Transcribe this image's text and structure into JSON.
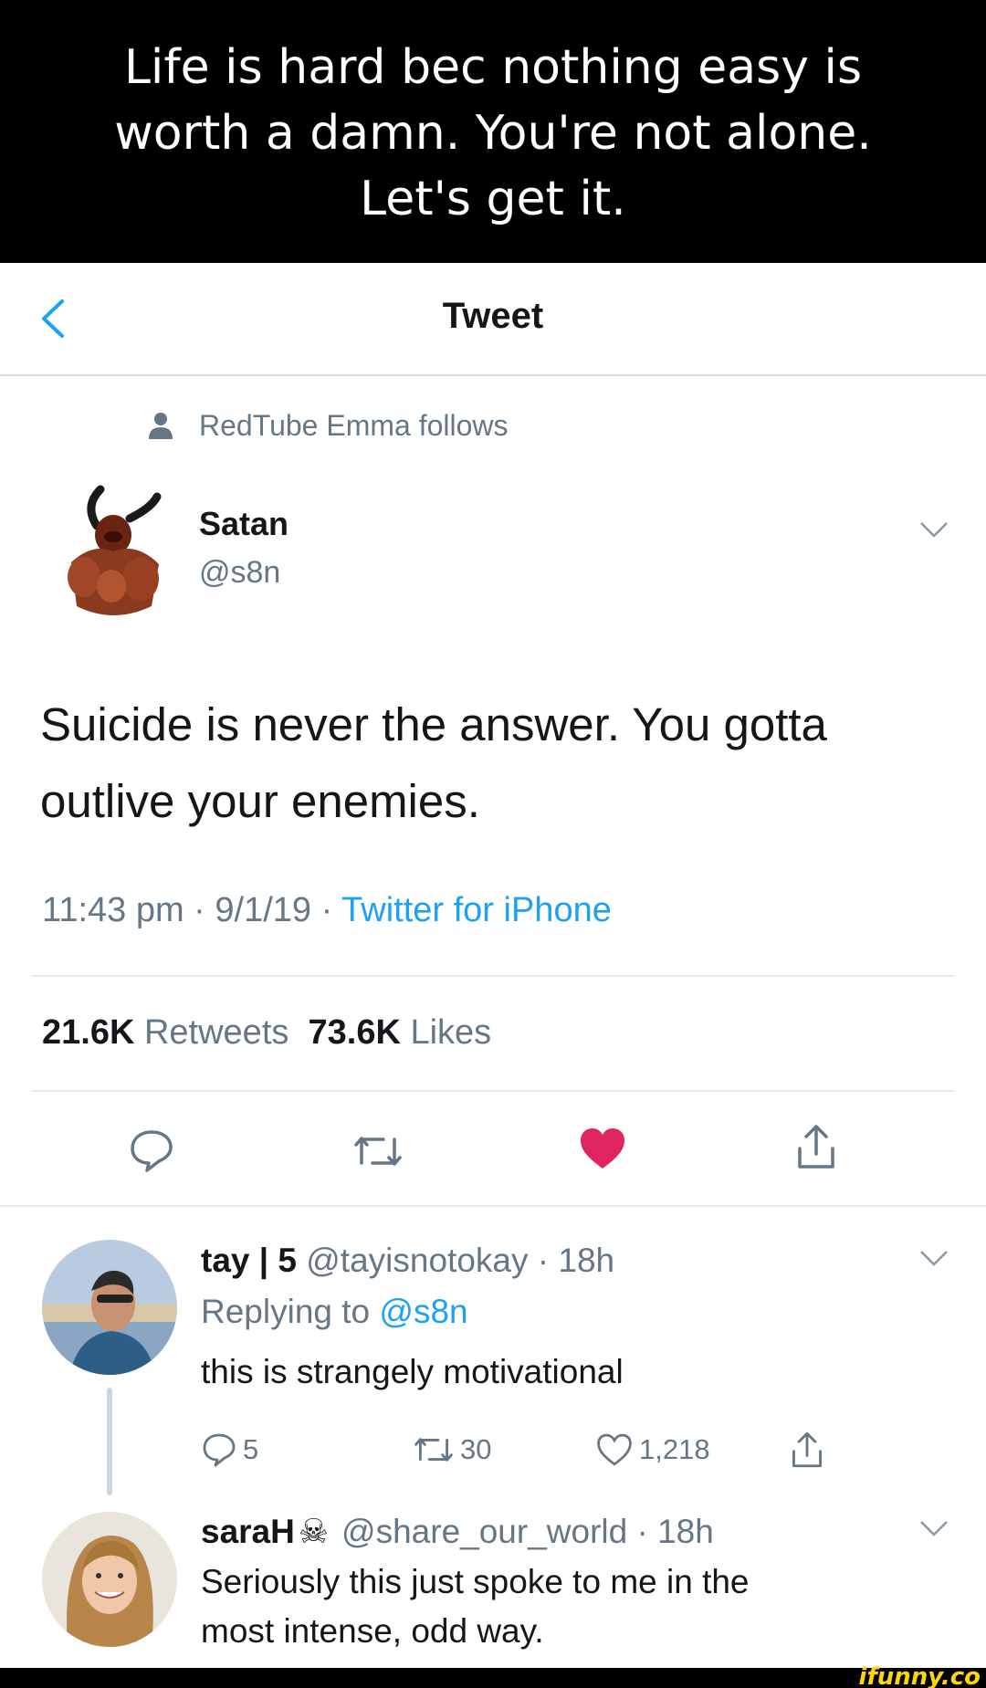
{
  "caption": {
    "line1": "Life is hard bec nothing easy is",
    "line2": "worth a damn. You're not alone.",
    "line3": "Let's get it."
  },
  "header": {
    "title": "Tweet"
  },
  "social_context": "RedTube Emma follows",
  "tweet": {
    "author_name": "Satan",
    "author_handle": "@s8n",
    "text": "Suicide is never the answer. You gotta outlive your enemies.",
    "time": "11:43 pm",
    "date": "9/1/19",
    "source": "Twitter for iPhone",
    "separator": " · ",
    "retweets_count": "21.6K",
    "retweets_label": "Retweets",
    "likes_count": "73.6K",
    "likes_label": "Likes"
  },
  "replies": [
    {
      "name": "tay | 5",
      "handle": "@tayisnotokay",
      "age": "18h",
      "replying_prefix": "Replying to",
      "replying_to": "@s8n",
      "text": "this is strangely motivational",
      "reply_count": "5",
      "retweet_count": "30",
      "like_count": "1,218"
    },
    {
      "name": "saraH",
      "handle": "@share_our_world",
      "age": "18h",
      "text_line1": "Seriously this just spoke to me in the",
      "text_line2": "most intense, odd way."
    }
  ],
  "watermark": "ifunny.co",
  "colors": {
    "accent": "#1da1f2",
    "like": "#e0245e",
    "secondary_text": "#657786"
  }
}
